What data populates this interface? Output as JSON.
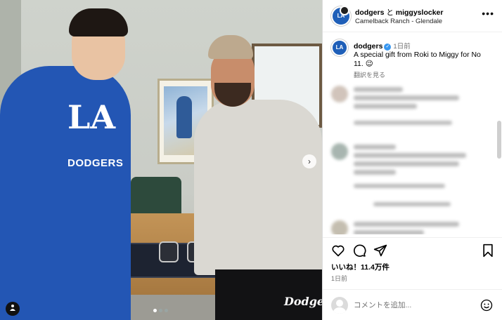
{
  "post": {
    "accounts": [
      "dodgers",
      "miggyslocker"
    ],
    "joiner": " と ",
    "location": "Camelback Ranch - Glendale",
    "more_menu": "•••"
  },
  "caption": {
    "username": "dodgers",
    "verified": "✓",
    "time": "1日前",
    "text": "A special gift from Roki to Miggy for No 11. 😉",
    "translate": "翻訳を見る"
  },
  "photo": {
    "jersey_logo": "LA",
    "jersey_text": "DODGERS",
    "pants_logo": "Dodgers",
    "next": "›",
    "carousel_dots": 3,
    "active_dot": 0
  },
  "actions": {
    "likes": "いいね！11.4万件",
    "date": "1日前"
  },
  "add_comment": {
    "placeholder": "コメントを追加..."
  },
  "icons": {
    "more": "more-horizontal-icon",
    "like": "heart-icon",
    "comment": "comment-bubble-icon",
    "share": "paper-plane-icon",
    "save": "bookmark-icon",
    "emoji": "smiley-icon",
    "user_tag": "person-tag-icon"
  },
  "colors": {
    "verified": "#3897f0",
    "dodger_blue": "#2356b4"
  }
}
